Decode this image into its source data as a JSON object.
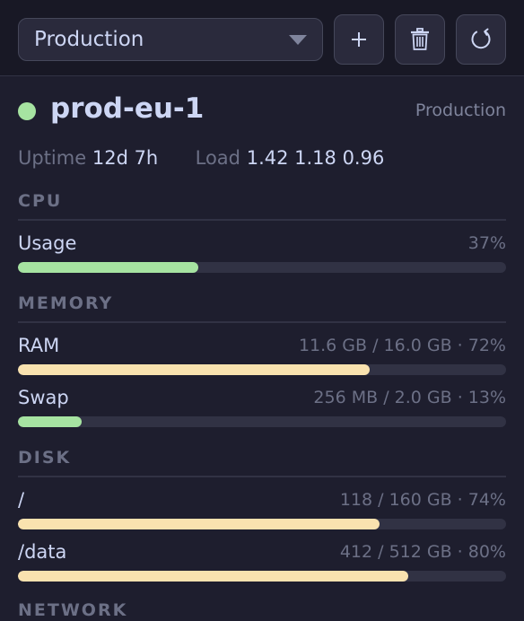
{
  "toolbar": {
    "environment_select": {
      "value": "Production"
    },
    "buttons": {
      "add": {
        "icon": "plus-icon"
      },
      "delete": {
        "icon": "trash-icon"
      },
      "refresh": {
        "icon": "refresh-icon"
      }
    }
  },
  "server": {
    "status": "online",
    "status_color": "#a6e3a1",
    "name": "prod-eu-1",
    "environment": "Production"
  },
  "stats": {
    "uptime_label": "Uptime",
    "uptime_value": "12d 7h",
    "load_label": "Load",
    "load_value": "1.42 1.18 0.96"
  },
  "sections": {
    "cpu": {
      "title": "CPU",
      "metrics": [
        {
          "label": "Usage",
          "value_text": "37%",
          "fraction": 0.37,
          "color": "#a6e3a1"
        }
      ]
    },
    "memory": {
      "title": "MEMORY",
      "metrics": [
        {
          "label": "RAM",
          "value_text": "11.6 GB / 16.0 GB · 72%",
          "fraction": 0.72,
          "color": "#f9e2af"
        },
        {
          "label": "Swap",
          "value_text": "256 MB / 2.0 GB · 13%",
          "fraction": 0.13,
          "color": "#a6e3a1"
        }
      ]
    },
    "disk": {
      "title": "DISK",
      "metrics": [
        {
          "label": "/",
          "value_text": "118 / 160 GB · 74%",
          "fraction": 0.74,
          "color": "#f9e2af"
        },
        {
          "label": "/data",
          "value_text": "412 / 512 GB · 80%",
          "fraction": 0.8,
          "color": "#f9e2af"
        }
      ]
    },
    "network": {
      "title": "NETWORK"
    }
  }
}
